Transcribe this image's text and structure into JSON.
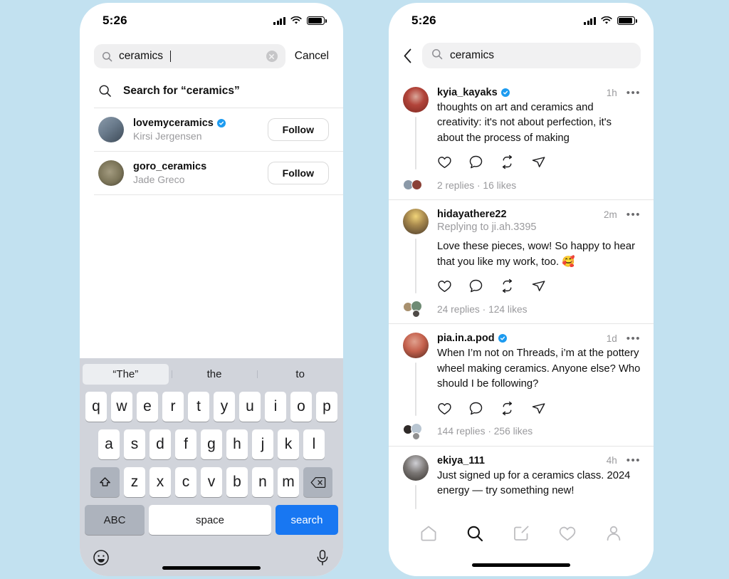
{
  "background_color": "#c2e1f0",
  "accent_color": "#1877f2",
  "verified_color": "#1d9bf0",
  "left_phone": {
    "status": {
      "time": "5:26",
      "signal_icon": "cellular-bars-icon",
      "wifi_icon": "wifi-icon",
      "battery_icon": "battery-full-icon"
    },
    "search": {
      "icon": "search-icon",
      "value": "ceramics",
      "placeholder": "Search",
      "clear_icon": "clear-circle-icon",
      "cancel_label": "Cancel"
    },
    "search_for": {
      "icon": "search-icon",
      "label": "Search for “ceramics”"
    },
    "accounts": [
      {
        "handle": "lovemyceramics",
        "name": "Kirsi Jergensen",
        "verified": true,
        "follow_label": "Follow",
        "avatar_colors": [
          "#7c8fa3",
          "#4d5f73"
        ]
      },
      {
        "handle": "goro_ceramics",
        "name": "Jade Greco",
        "verified": false,
        "follow_label": "Follow",
        "avatar_colors": [
          "#8f8a72",
          "#5d5947"
        ]
      }
    ],
    "keyboard": {
      "suggestions": [
        {
          "label": "“The”",
          "selected": true
        },
        {
          "label": "the",
          "selected": false
        },
        {
          "label": "to",
          "selected": false
        }
      ],
      "row1": [
        "q",
        "w",
        "e",
        "r",
        "t",
        "y",
        "u",
        "i",
        "o",
        "p"
      ],
      "row2": [
        "a",
        "s",
        "d",
        "f",
        "g",
        "h",
        "j",
        "k",
        "l"
      ],
      "row3": [
        "z",
        "x",
        "c",
        "v",
        "b",
        "n",
        "m"
      ],
      "shift_icon": "shift-arrow-icon",
      "backspace_icon": "backspace-icon",
      "abc_label": "ABC",
      "space_label": "space",
      "search_label": "search",
      "emoji_icon": "emoji-smiley-icon",
      "mic_icon": "microphone-icon"
    }
  },
  "right_phone": {
    "status": {
      "time": "5:26",
      "signal_icon": "cellular-bars-icon",
      "wifi_icon": "wifi-icon",
      "battery_icon": "battery-full-icon"
    },
    "header": {
      "back_icon": "back-chevron-icon",
      "search_icon": "search-icon",
      "query": "ceramics"
    },
    "posts": [
      {
        "handle": "kyia_kayaks",
        "verified": true,
        "time": "1h",
        "menu_icon": "more-dots-icon",
        "replying_to": "",
        "text": "thoughts on art and ceramics and creativity: it's not about perfection, it's about the process of making",
        "actions": [
          "like-heart-icon",
          "reply-comment-icon",
          "repost-icon",
          "share-icon"
        ],
        "footer": "2 replies  ·  16 likes",
        "avatar_colors": [
          "#c8493f",
          "#7a2d26"
        ],
        "footer_avatars": [
          "#8b99a8",
          "#8a4036"
        ]
      },
      {
        "handle": "hidayathere22",
        "verified": false,
        "time": "2m",
        "menu_icon": "more-dots-icon",
        "replying_to": "Replying to ji.ah.3395",
        "text": "Love these pieces, wow! So happy to hear that you like my work, too. 🥰",
        "actions": [
          "like-heart-icon",
          "reply-comment-icon",
          "repost-icon",
          "share-icon"
        ],
        "footer": "24 replies  ·  124 likes",
        "avatar_colors": [
          "#e8c768",
          "#5a4631"
        ],
        "footer_avatars": [
          "#a8906e",
          "#6f8b74",
          "#4e4a46"
        ]
      },
      {
        "handle": "pia.in.a.pod",
        "verified": true,
        "time": "1d",
        "menu_icon": "more-dots-icon",
        "replying_to": "",
        "text": "When I’m not on Threads, i’m at the pottery wheel making ceramics. Anyone else? Who should I be following?",
        "actions": [
          "like-heart-icon",
          "reply-comment-icon",
          "repost-icon",
          "share-icon"
        ],
        "footer": "144 replies  ·  256 likes",
        "avatar_colors": [
          "#d16b5a",
          "#4a2a22"
        ],
        "footer_avatars": [
          "#2f2a28",
          "#b9c6d2",
          "#8f8f8f"
        ]
      },
      {
        "handle": "ekiya_111",
        "verified": false,
        "time": "4h",
        "menu_icon": "more-dots-icon",
        "replying_to": "",
        "text": "Just signed up for a ceramics class. 2024 energy — try something new!",
        "actions": [],
        "footer": "",
        "avatar_colors": [
          "#9a9aa0",
          "#3e3a38"
        ],
        "footer_avatars": []
      }
    ],
    "bottom_nav": [
      {
        "name": "home-icon",
        "active": false
      },
      {
        "name": "search-icon",
        "active": true
      },
      {
        "name": "compose-icon",
        "active": false
      },
      {
        "name": "activity-heart-icon",
        "active": false
      },
      {
        "name": "profile-icon",
        "active": false
      }
    ]
  }
}
